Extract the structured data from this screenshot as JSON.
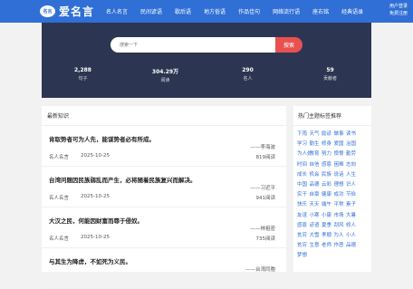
{
  "header": {
    "logo_badge": "名言",
    "logo_text": "爱名言",
    "nav": [
      "名人名言",
      "民间谚语",
      "歇后语",
      "地方俗语",
      "作品佳句",
      "网络流行语",
      "座右铭",
      "经典语录"
    ],
    "user_line1": "用户登录",
    "user_line2": "免费注册"
  },
  "hero": {
    "search_placeholder": "搜索一下",
    "search_button": "搜索",
    "stats": [
      {
        "value": "2,288",
        "label": "句子"
      },
      {
        "value": "304.29万",
        "label": "阅读"
      },
      {
        "value": "290",
        "label": "名人"
      },
      {
        "value": "59",
        "label": "贡献者"
      }
    ]
  },
  "latest": {
    "title": "最新知识",
    "entries": [
      {
        "quote": "肯取势者可为人先，能谋势者必有所成。",
        "author": "——李海波",
        "category": "名人名言",
        "date": "2025-10-25",
        "reads": "819阅读"
      },
      {
        "quote": "台湾问题因民族弱乱而产生，必将随着民族复兴而解决。",
        "author": "——习近平",
        "category": "名人名言",
        "date": "2025-10-25",
        "reads": "941阅读"
      },
      {
        "quote": "大汉之民，何能因财富而辱于侵奴。",
        "author": "——林祖密",
        "category": "名人名言",
        "date": "2025-10-25",
        "reads": "735阅读"
      },
      {
        "quote": "与其生为降虏，不如死为义民。",
        "author": "——台湾同胞",
        "category": "",
        "date": "",
        "reads": ""
      }
    ]
  },
  "sidebar": {
    "title": "热门主题标签推荐",
    "tags": [
      "下雨",
      "天气",
      "励谚",
      "做事",
      "读书",
      "学习",
      "勤生",
      "修身",
      "爱国",
      "治国",
      "为人处世",
      "教育",
      "努力",
      "憎恨",
      "勤劳",
      "时间",
      "自信",
      "感恩",
      "困难",
      "志向",
      "成长",
      "机会",
      "民族",
      "说话",
      "人生",
      "中国",
      "品德",
      "云彩",
      "理想",
      "识人",
      "实干",
      "自豪",
      "健康",
      "成功",
      "节俭",
      "快乐",
      "天天",
      "端午",
      "平常",
      "素子",
      "友谊",
      "小寒",
      "小康",
      "市场",
      "大暑",
      "感恩",
      "谚语",
      "夏季",
      "刮风",
      "修人",
      "贫穷",
      "大雪",
      "孝顺",
      "为人",
      "小人",
      "贫穷",
      "生意",
      "老师",
      "作恶",
      "品德",
      "梦想"
    ]
  },
  "colors": {
    "brand": "#2f6fd6",
    "hero_bg": "#2c3652",
    "search_btn": "#e8514f"
  }
}
